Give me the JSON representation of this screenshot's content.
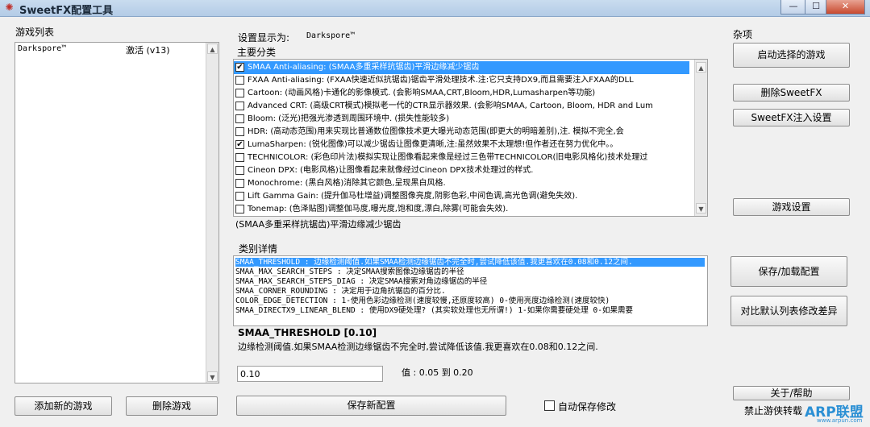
{
  "window": {
    "title": "SweetFX配置工具",
    "min": "—",
    "max": "☐",
    "close": "✕",
    "icon": "app-icon"
  },
  "games": {
    "label": "游戏列表",
    "items": [
      {
        "name": "Darkspore™",
        "status": "激活 (v13)"
      }
    ],
    "add_button": "添加新的游戏",
    "delete_button": "删除游戏"
  },
  "settings": {
    "display_label": "设置显示为:",
    "display_value": "Darkspore™",
    "category_label": "主要分类",
    "effects": [
      {
        "checked": true,
        "text": "SMAA Anti-aliasing: (SMAA多重采样抗锯齿)平滑边缘减少锯齿",
        "selected": true
      },
      {
        "checked": false,
        "text": "FXAA Anti-aliasing: (FXAA快速近似抗锯齿)锯齿平滑处理技术.注:它只支持DX9,而且需要注入FXAA的DLL"
      },
      {
        "checked": false,
        "text": "Cartoon: (动画风格)卡通化的影像模式. (会影响SMAA,CRT,Bloom,HDR,Lumasharpen等功能)"
      },
      {
        "checked": false,
        "text": "Advanced CRT: (高级CRT模式)模拟老一代的CTR显示器效果. (会影响SMAA, Cartoon, Bloom, HDR and Lum"
      },
      {
        "checked": false,
        "text": "Bloom: (泛光)把强光渗透到周围环境中. (损失性能较多)"
      },
      {
        "checked": false,
        "text": "HDR: (高动态范围)用来实现比普通数位图像技术更大曝光动态范围(即更大的明暗差别),注. 模拟不完全,会"
      },
      {
        "checked": true,
        "text": "LumaSharpen: (锐化图像)可以减少锯齿让图像更清晰,注:虽然效果不太理想!但作者还在努力优化中。。"
      },
      {
        "checked": false,
        "text": "TECHNICOLOR: (彩色印片法)模拟实现让图像看起来像是经过三色带TECHNICOLOR(旧电影风格化)技术处理过"
      },
      {
        "checked": false,
        "text": "Cineon DPX: (电影风格)让图像看起来就像经过Cineon DPX技术处理过的样式."
      },
      {
        "checked": false,
        "text": "Monochrome: (黑白风格)消除其它颜色,呈现黑白风格."
      },
      {
        "checked": false,
        "text": "Lift Gamma Gain: (提升伽马杜增益)调整图像亮度,阴影色彩,中间色调,高光色调(避免失效)."
      },
      {
        "checked": false,
        "text": "Tonemap: (色泽贴图)调整伽马度,曝光度,饱和度,漂白,除雾(可能会失效)."
      }
    ],
    "effect_caption": "(SMAA多重采样抗锯齿)平滑边缘减少锯齿",
    "detail_label": "类别详情",
    "details": [
      {
        "text": "SMAA_THRESHOLD : 边缘检测阈值.如果SMAA检测边缘锯齿不完全时,尝试降低该值.我更喜欢在0.08和0.12之间.",
        "selected": true
      },
      {
        "text": "SMAA_MAX_SEARCH_STEPS : 决定SMAA搜索图像边缘锯齿的半径"
      },
      {
        "text": "SMAA_MAX_SEARCH_STEPS_DIAG : 决定SMAA搜索对角边缘锯齿的半径"
      },
      {
        "text": "SMAA_CORNER_ROUNDING : 决定用于边角抗锯齿的百分比."
      },
      {
        "text": "COLOR_EDGE_DETECTION : 1-使用色彩边缘检测(速度较慢,还原度较高) 0-使用亮度边缘检测(速度较快)"
      },
      {
        "text": "SMAA_DIRECTX9_LINEAR_BLEND : 使用DX9硬处理? (其实软处理也无所谓!) 1-如果你需要硬处理 0-如果需要"
      }
    ],
    "param_name": "SMAA_THRESHOLD [0.10]",
    "param_desc": "边缘检测阈值.如果SMAA检测边缘锯齿不完全时,尝试降低该值.我更喜欢在0.08和0.12之间.",
    "value_input": "0.10",
    "range_text": "值 : 0.05 到 0.20",
    "save_button": "保存新配置",
    "autosave_label": "自动保存修改",
    "autosave_checked": false
  },
  "misc": {
    "label": "杂项",
    "launch_button": "启动选择的游戏",
    "delete_sweetfx_button": "删除SweetFX",
    "inject_button": "SweetFX注入设置",
    "game_settings_button": "游戏设置",
    "save_load_button": "保存/加载配置",
    "compare_button": "对比默认列表修改差异",
    "about_button": "关于/帮助",
    "disable_text": "禁止游侠转载"
  },
  "watermark": {
    "main": "ARP联盟",
    "sub": "www.arpun.com"
  }
}
